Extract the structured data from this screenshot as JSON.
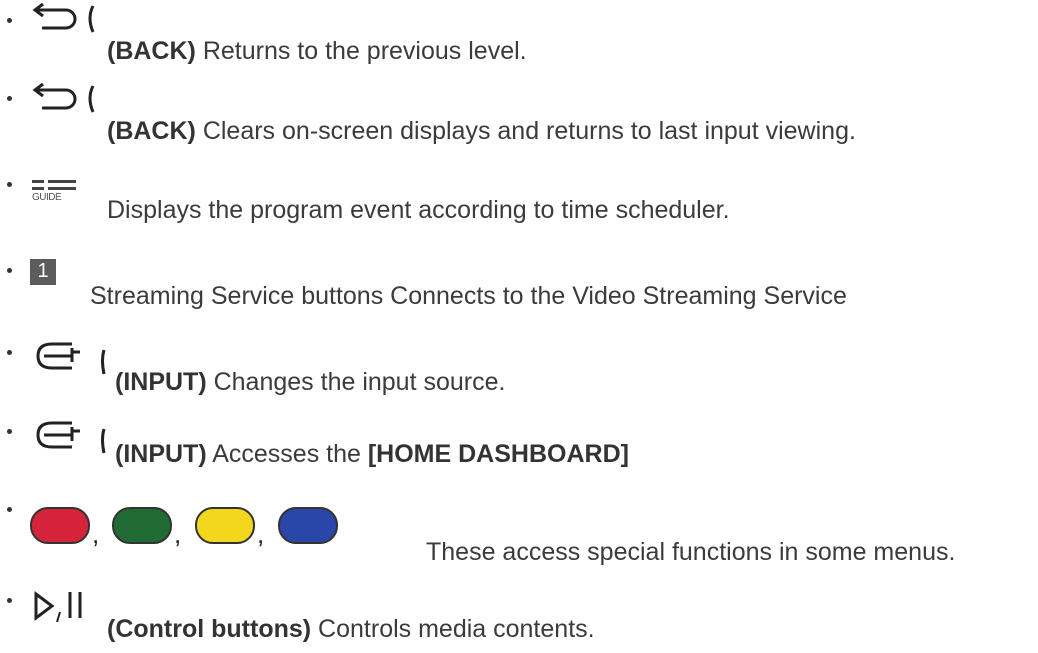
{
  "items": [
    {
      "bold": "(BACK)",
      "text": " Returns to the previous level.",
      "icon": "back-icon"
    },
    {
      "bold": "(BACK)",
      "text": " Clears on-screen displays and returns to last input viewing.",
      "icon": "back-icon"
    },
    {
      "icon_label": "GUIDE",
      "text": "Displays the program event according to time scheduler.",
      "icon": "guide-icon"
    },
    {
      "icon_label": "1",
      "text": "Streaming Service buttons Connects to the Video Streaming Service",
      "icon": "streaming-service-1-icon"
    },
    {
      "bold": "(INPUT)",
      "text": " Changes the input source.",
      "icon": "input-icon"
    },
    {
      "bold": "(INPUT)",
      "text": " Accesses the ",
      "bold2": "[HOME DASHBOARD]",
      "icon": "input-icon"
    },
    {
      "text": "These access special functions in some menus.",
      "icon": "color-buttons-icon",
      "colors": [
        "#d5233b",
        "#1f6b33",
        "#f2d71c",
        "#2a46a8"
      ]
    },
    {
      "bold": "(Control buttons)",
      "text": " Controls media contents.",
      "icon": "play-pause-icon"
    }
  ]
}
